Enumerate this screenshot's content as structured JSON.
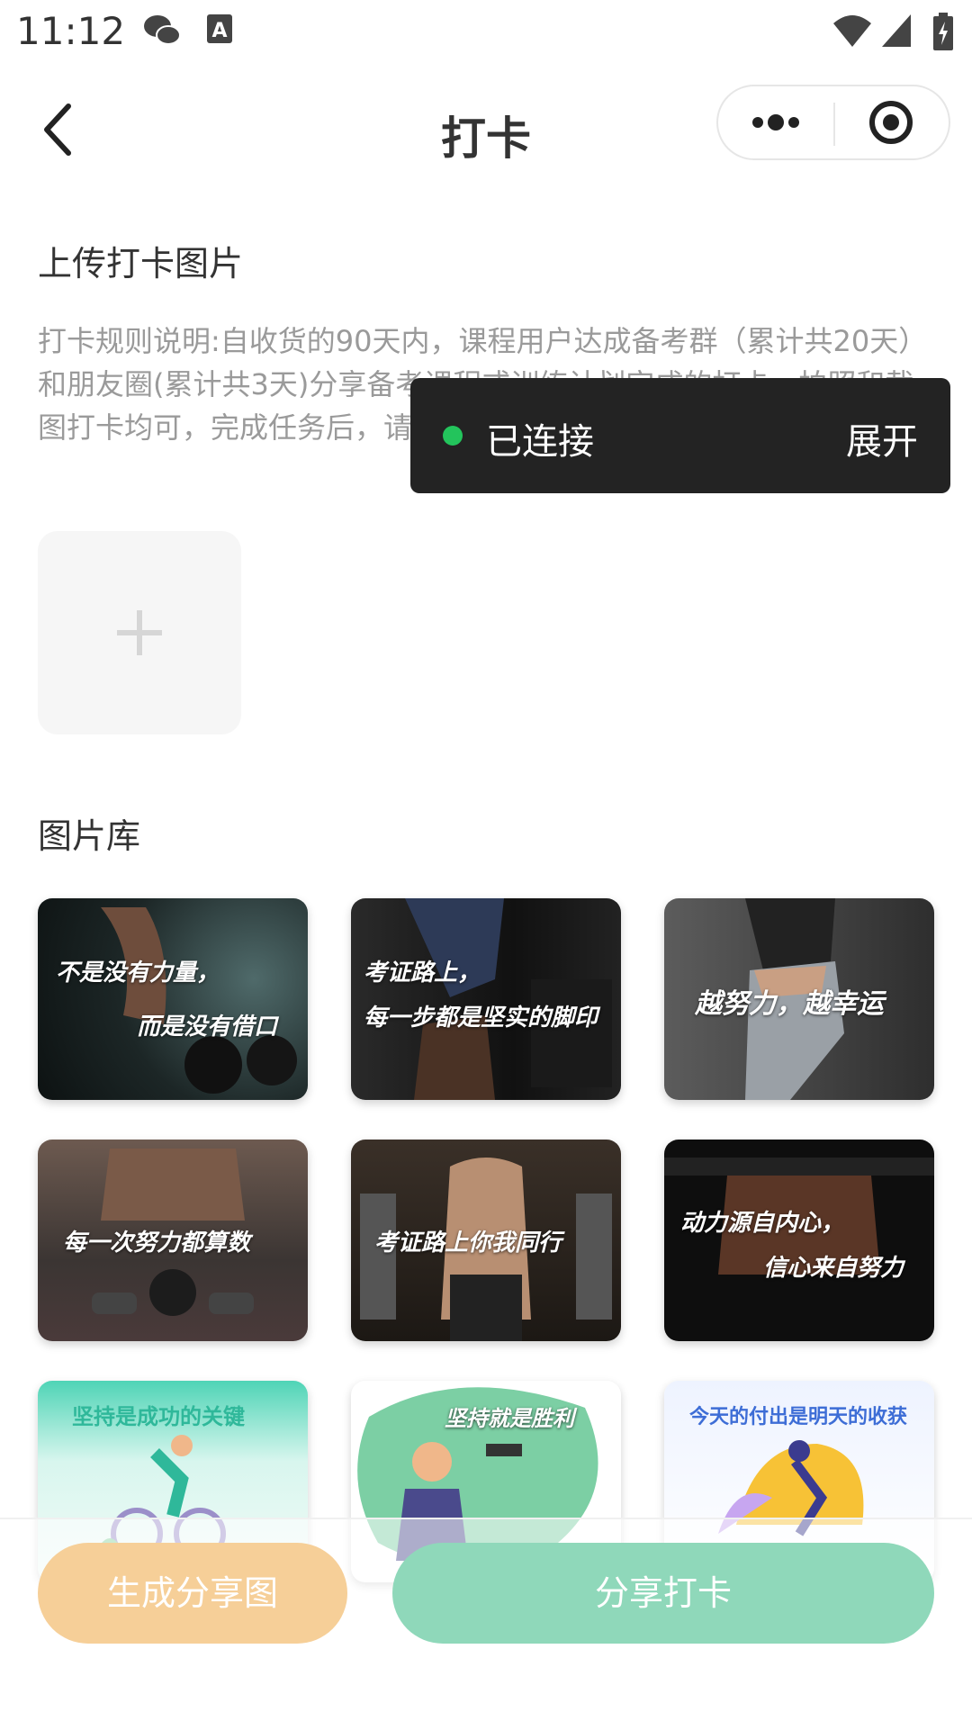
{
  "status_bar": {
    "time": "11:12"
  },
  "header": {
    "title": "打卡"
  },
  "upload": {
    "title": "上传打卡图片",
    "rules": "打卡规则说明:自收货的90天内，课程用户达成备考群（累计共20天）和朋友圈(累计共3天)分享备考课程或训练计划完成的打卡，拍照和截图打卡均可，完成任务后，请联系客服，课程讲义费用即返！！"
  },
  "toast": {
    "text": "已连接",
    "action": "展开"
  },
  "gallery": {
    "title": "图片库",
    "items": [
      {
        "line1": "不是没有力量，",
        "line2": "而是没有借口"
      },
      {
        "line1": "考证路上，",
        "line2": "每一步都是坚实的脚印"
      },
      {
        "line1": "越努力，越幸运"
      },
      {
        "line1": "每一次努力都算数"
      },
      {
        "line1": "考证路上你我同行"
      },
      {
        "line1": "动力源自内心，",
        "line2": "信心来自努力"
      },
      {
        "line1": "坚持是成功的关键"
      },
      {
        "line1": "坚持就是胜利"
      },
      {
        "line1": "今天的付出是明天的收获"
      }
    ]
  },
  "actions": {
    "generate": "生成分享图",
    "share": "分享打卡"
  }
}
